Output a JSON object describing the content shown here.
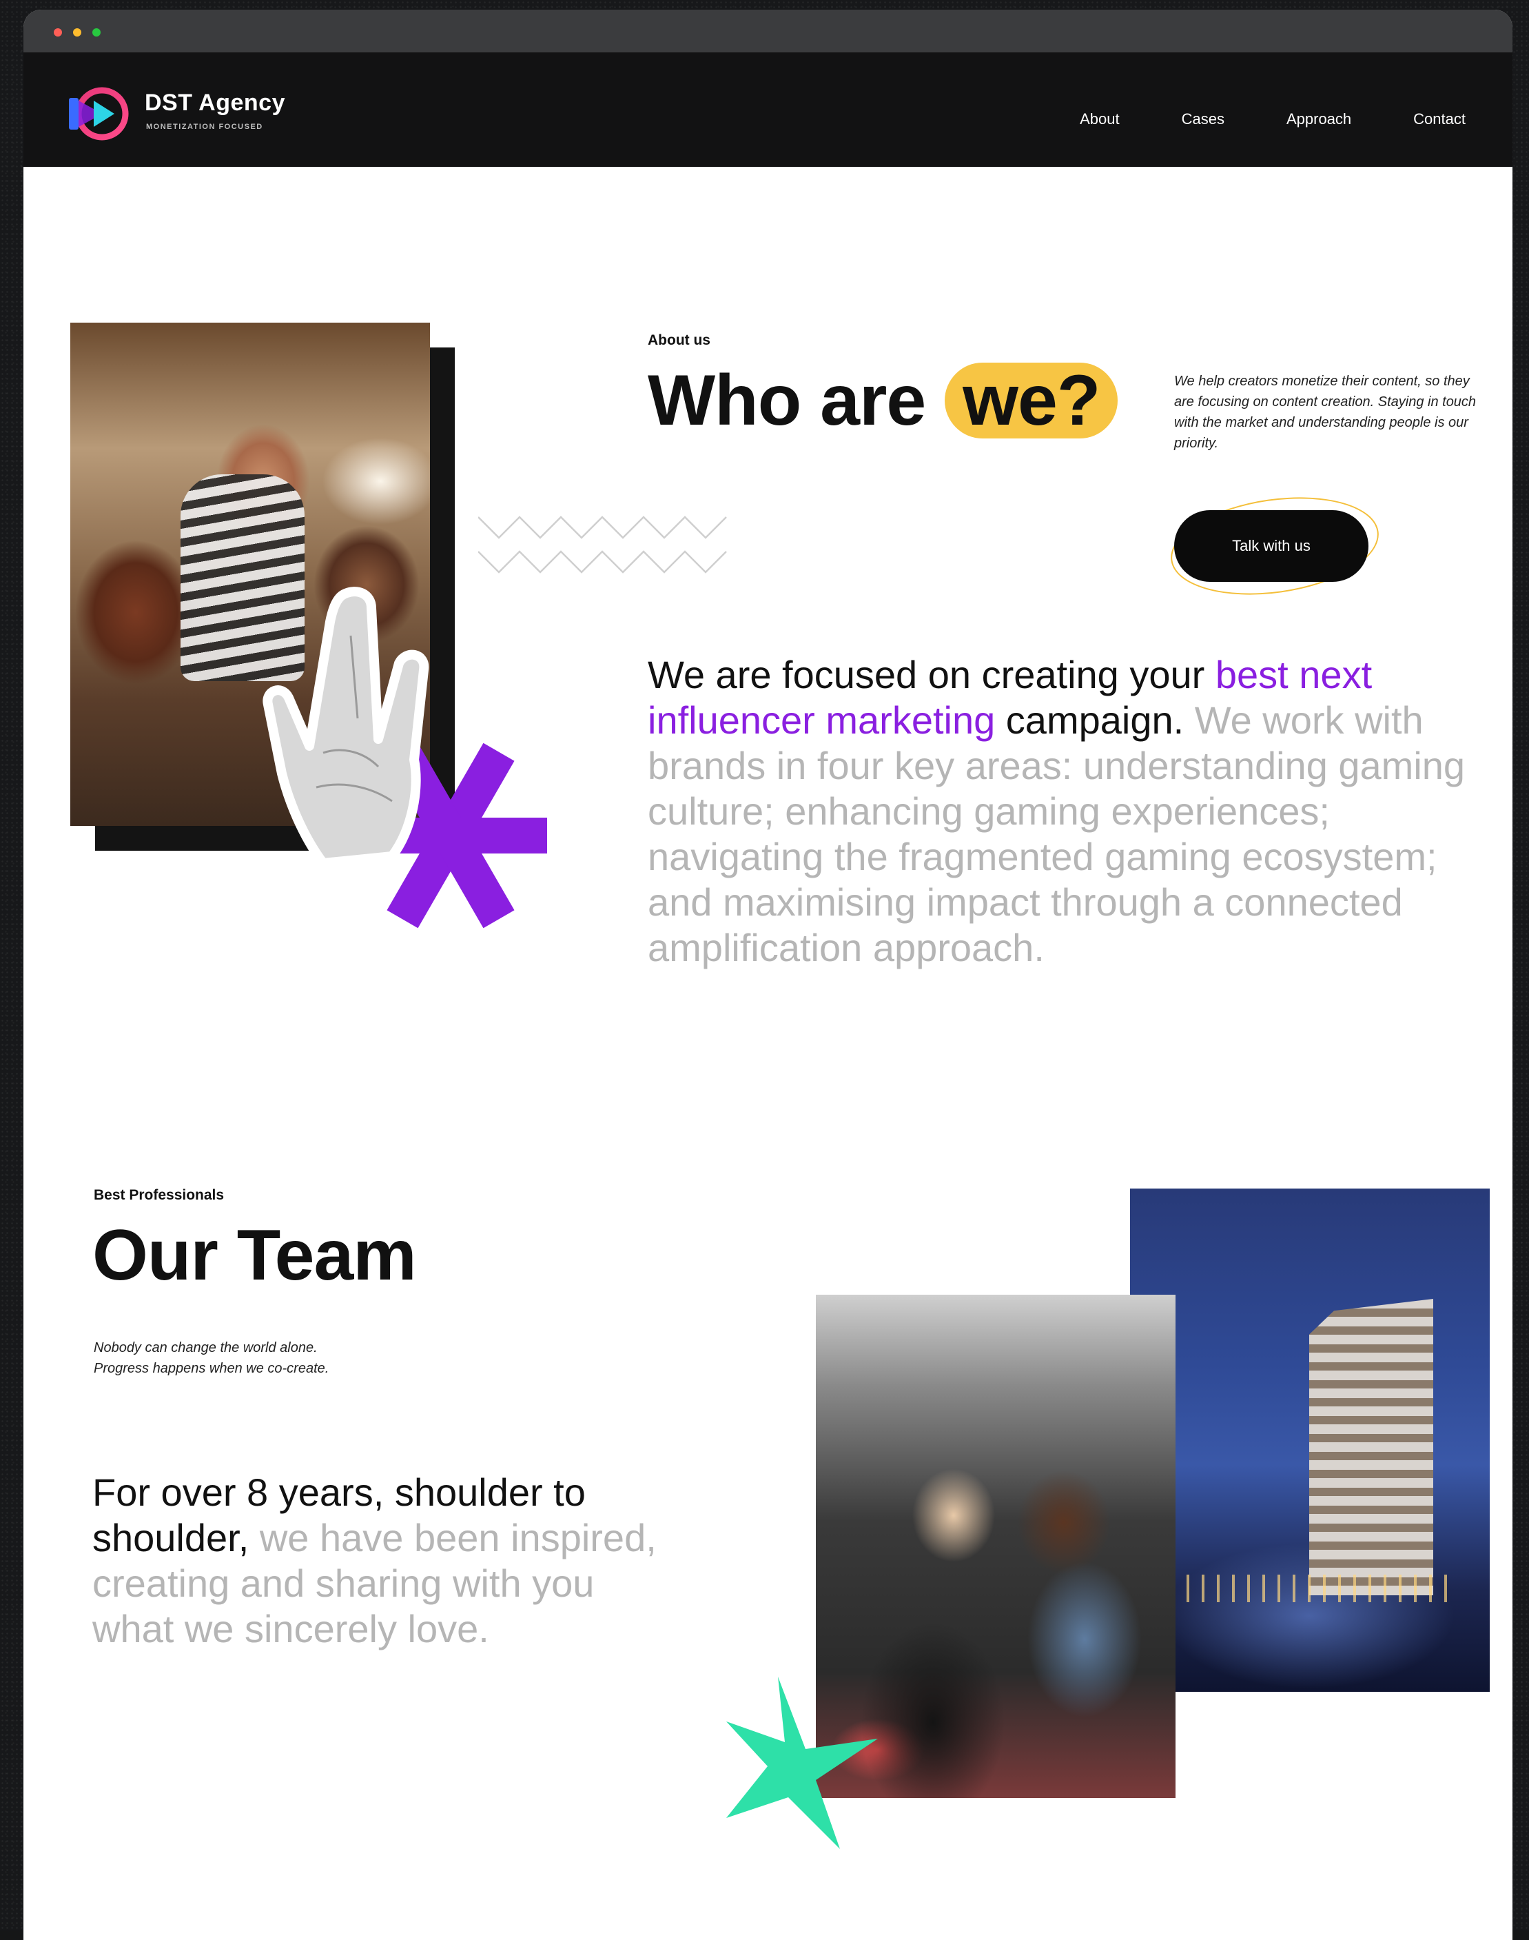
{
  "window": {
    "dots": [
      "red",
      "yellow",
      "green"
    ]
  },
  "brand": {
    "name": "DST Agency",
    "tagline": "MONETIZATION FOCUSED",
    "colors": {
      "pink": "#e8397a",
      "cyan": "#2dd4e6",
      "purple": "#8a1fe0",
      "yellow": "#f7c544",
      "green": "#2ee0a8"
    }
  },
  "nav": {
    "items": [
      "About",
      "Cases",
      "Approach",
      "Contact"
    ]
  },
  "about": {
    "label": "About us",
    "title_plain": "Who are ",
    "title_highlight": "we?",
    "description": "We help creators monetize their content, so they are focusing on content creation. Staying in touch with the market and understanding people is our priority.",
    "cta": "Talk with us",
    "para_dark_1": "We are focused on creating your ",
    "para_purple": "best next influencer marketing",
    "para_dark_2": " campaign.",
    "para_light": " We work with brands in four key areas: understanding gaming culture; enhancing gaming experiences; navigating the fragmented gaming ecosystem; and maximising impact through a connected amplification approach."
  },
  "team": {
    "label": "Best Professionals",
    "title": "Our Team",
    "description_line1": "Nobody can change the world alone.",
    "description_line2": "Progress happens when we co-create.",
    "para_dark": "For over 8 years, shoulder to shoulder,",
    "para_light": " we have been inspired, creating and sharing with you what we sincerely love."
  },
  "icons": {
    "logo": "play-circle-logo-icon",
    "hand": "rock-on-hand-icon",
    "asterisk": "purple-asterisk-icon",
    "star": "green-star-icon",
    "zigzag": "zigzag-lines-icon"
  }
}
